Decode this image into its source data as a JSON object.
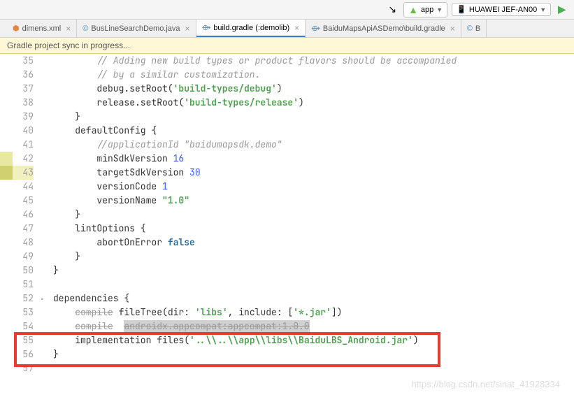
{
  "toolbar": {
    "module": "app",
    "device": "HUAWEI JEF-AN00"
  },
  "tabs": [
    {
      "icon": "xml",
      "label": "dimens.xml"
    },
    {
      "icon": "java",
      "label": "BusLineSearchDemo.java"
    },
    {
      "icon": "gradle",
      "label": "build.gradle (:demolib)",
      "active": true
    },
    {
      "icon": "gradle",
      "label": "BaiduMapsApiASDemo\\build.gradle"
    },
    {
      "icon": "java",
      "label": "B"
    }
  ],
  "notification": "Gradle project sync in progress...",
  "lines": [
    {
      "n": 35,
      "html": "        <span class='comment'>// Adding new build types or product flavors should be accompanied</span>"
    },
    {
      "n": 36,
      "html": "        <span class='comment'>// by a similar customization.</span>"
    },
    {
      "n": 37,
      "html": "        debug.setRoot(<span class='str'>'build-types/debug'</span>)"
    },
    {
      "n": 38,
      "html": "        release.setRoot(<span class='str'>'build-types/release'</span>)"
    },
    {
      "n": 39,
      "html": "    }"
    },
    {
      "n": 40,
      "html": "    defaultConfig {"
    },
    {
      "n": 41,
      "html": "        <span class='comment'>//applicationId \"baidumapsdk.demo\"</span>"
    },
    {
      "n": 42,
      "html": "        minSdkVersion <span class='num'>16</span>",
      "hl": "light"
    },
    {
      "n": 43,
      "html": "        targetSdkVersion <span class='num'>30</span>",
      "hl": "change"
    },
    {
      "n": 44,
      "html": "        versionCode <span class='num'>1</span>"
    },
    {
      "n": 45,
      "html": "        versionName <span class='str'>\"1.0\"</span>"
    },
    {
      "n": 46,
      "html": "    }"
    },
    {
      "n": 47,
      "html": "    lintOptions {"
    },
    {
      "n": 48,
      "html": "        abortOnError <span class='kw'>false</span>"
    },
    {
      "n": 49,
      "html": "    }"
    },
    {
      "n": 50,
      "html": "}"
    },
    {
      "n": 51,
      "html": ""
    },
    {
      "n": 52,
      "html": "dependencies {",
      "fold": true
    },
    {
      "n": 53,
      "html": "    <span class='strike'>compile</span> fileTree(dir: <span class='str'>'libs'</span>, include: [<span class='str'>'*.jar'</span>])"
    },
    {
      "n": 54,
      "html": "    <span class='strike'>compile</span>  <span class='strike' style='background:#d0d0d0'>androidx.appcompat:appcompat:1.0.0</span>"
    },
    {
      "n": 55,
      "html": "    implementation files(<span class='bold-str'>'..\\\\..\\\\app\\\\libs\\\\BaiduLBS_Android.jar'</span>)"
    },
    {
      "n": 56,
      "html": "}"
    },
    {
      "n": 57,
      "html": ""
    }
  ],
  "watermark": "https://blog.csdn.net/sinat_41928334"
}
